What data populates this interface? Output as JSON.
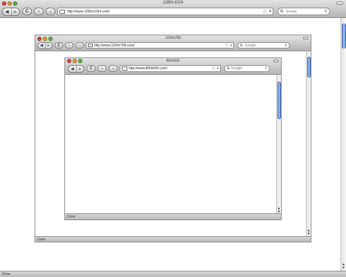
{
  "outer": {
    "title": "1280x1024",
    "nav": {
      "back_icon": "back-arrow-icon",
      "forward_icon": "forward-arrow-icon"
    },
    "url": "http://www.1280x1024.com/",
    "search_placeholder": "Google",
    "status": "Done"
  },
  "middle": {
    "title": "1024x768",
    "url": "http://www.1024x768.com/",
    "search_placeholder": "Google",
    "status": "Done"
  },
  "inner": {
    "title": "800x600",
    "url": "http://www.800x600.com/",
    "search_placeholder": "Google",
    "status": "Done"
  },
  "icons": {
    "back": "◀",
    "forward": "▶",
    "reload": "C",
    "stop": "✕",
    "home": "⌂",
    "star": "☆",
    "caret": "▾",
    "search_engine": "G",
    "magnifier": "⚲"
  },
  "colors": {
    "scroll_thumb": "#5f93dc",
    "chrome_top": "#e3e3e3",
    "chrome_bottom": "#b5b5b5"
  }
}
